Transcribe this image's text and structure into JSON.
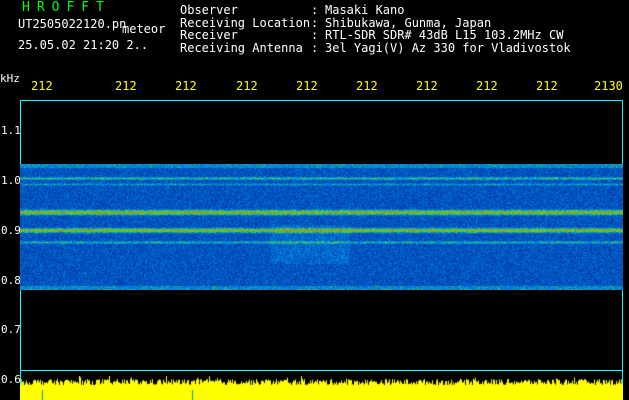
{
  "header": {
    "program_name": "HROFFT",
    "file_name": "UT2505022120.pn",
    "file_tag": "meteor",
    "datetime": "25.05.02 21:20    2.."
  },
  "station": [
    {
      "label": "Observer",
      "value": "Masaki Kano"
    },
    {
      "label": "Receiving Location",
      "value": "Shibukawa, Gunma, Japan"
    },
    {
      "label": "Receiver",
      "value": "RTL-SDR SDR# 43dB L15 103.2MHz CW"
    },
    {
      "label": "Receiving Antenna",
      "value": "3el Yagi(V) Az 330 for Vladivostok"
    }
  ],
  "separator": ":",
  "axis": {
    "unit": "kHz",
    "time_ticks": [
      "212",
      "212",
      "212",
      "212",
      "212",
      "212",
      "212",
      "212",
      "212",
      "2130"
    ],
    "freq_ticks": [
      "1.1",
      "1.0",
      "0.9",
      "0.8",
      "0.7",
      "0.6"
    ]
  },
  "colors": {
    "title": "#00ff00",
    "time_ticks": "#ffff00",
    "border": "#00ffff",
    "volume": "#ffff00",
    "noise_low": "#000090",
    "noise_high": "#00c8ff",
    "signal": "#ff3000"
  }
}
